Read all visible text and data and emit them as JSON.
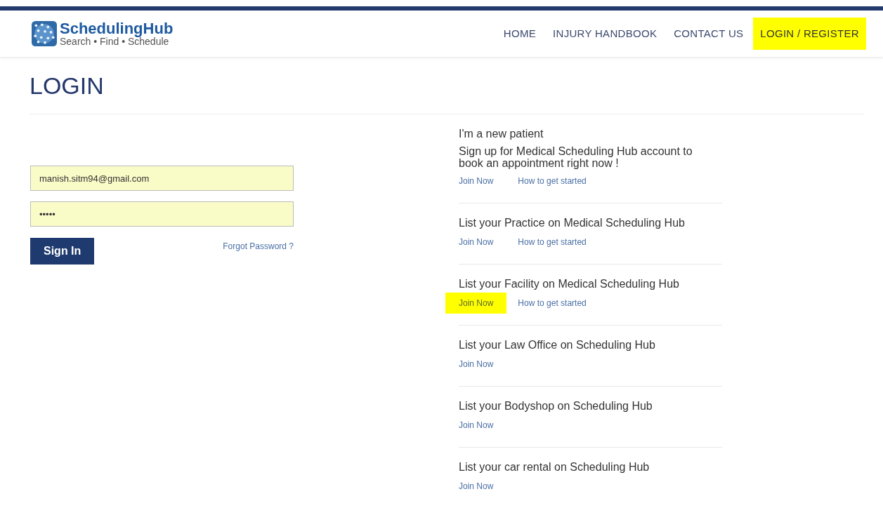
{
  "logo": {
    "name": "SchedulingHub",
    "tagline": "Search • Find • Schedule"
  },
  "nav": [
    {
      "label": "HOME",
      "highlighted": false
    },
    {
      "label": "INJURY HANDBOOK",
      "highlighted": false
    },
    {
      "label": "CONTACT US",
      "highlighted": false
    },
    {
      "label": "LOGIN / REGISTER",
      "highlighted": true
    }
  ],
  "page_title": "LOGIN",
  "login_form": {
    "email": "manish.sitm94@gmail.com",
    "password": "•••••",
    "submit": "Sign In",
    "forgot": "Forgot Password ?"
  },
  "sections": [
    {
      "title": "I'm a new patient",
      "description": "Sign up for Medical Scheduling Hub account to book an appointment right now !",
      "links": [
        {
          "label": "Join Now",
          "highlighted": false
        },
        {
          "label": "How to get started",
          "highlighted": false
        }
      ]
    },
    {
      "title": "List your Practice on Medical Scheduling Hub",
      "links": [
        {
          "label": "Join Now",
          "highlighted": false
        },
        {
          "label": "How to get started",
          "highlighted": false
        }
      ]
    },
    {
      "title": "List your Facility on Medical Scheduling Hub",
      "links": [
        {
          "label": "Join Now",
          "highlighted": true
        },
        {
          "label": "How to get started",
          "highlighted": false
        }
      ]
    },
    {
      "title": "List your Law Office on Scheduling Hub",
      "links": [
        {
          "label": "Join Now",
          "highlighted": false
        }
      ]
    },
    {
      "title": "List your Bodyshop on Scheduling Hub",
      "links": [
        {
          "label": "Join Now",
          "highlighted": false
        }
      ]
    },
    {
      "title": "List your car rental on Scheduling Hub",
      "links": [
        {
          "label": "Join Now",
          "highlighted": false
        }
      ]
    }
  ]
}
